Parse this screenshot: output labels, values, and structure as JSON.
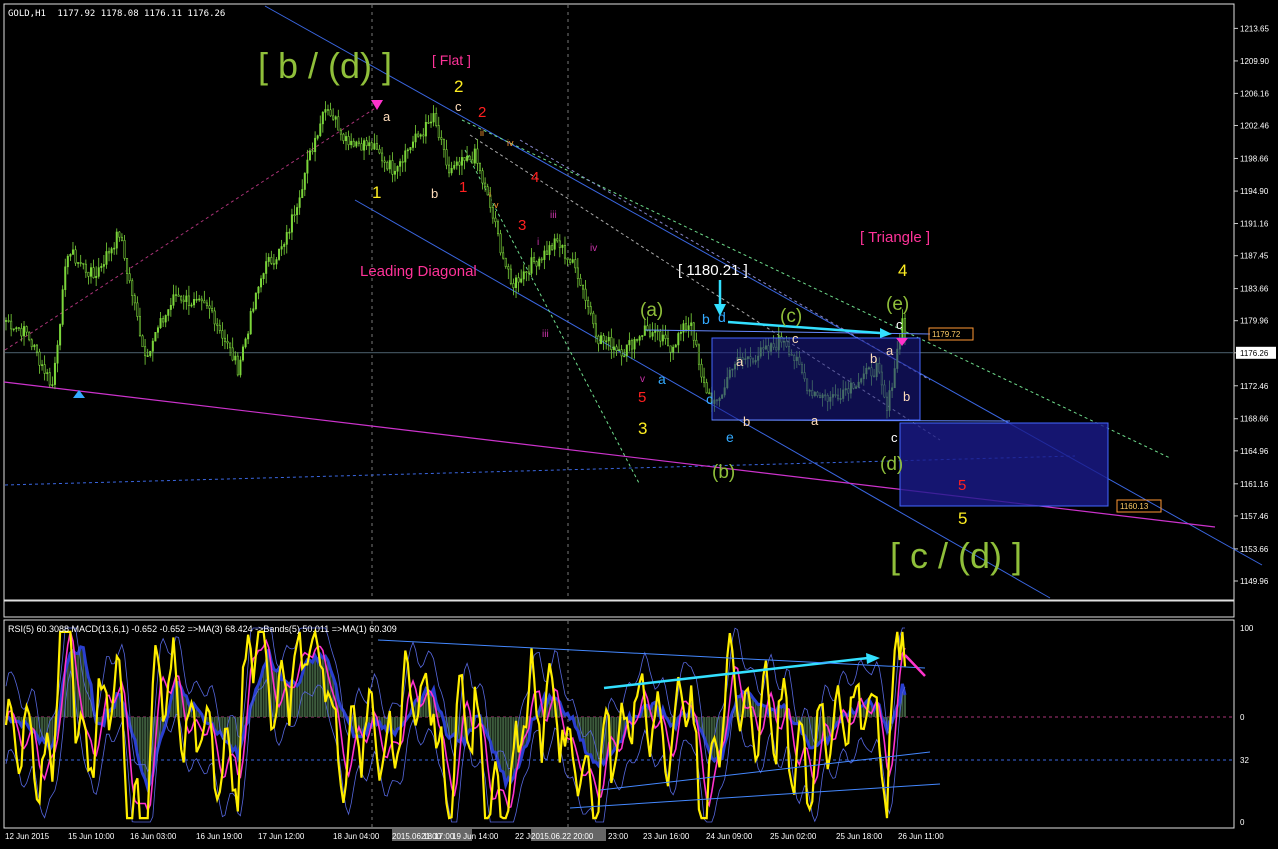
{
  "header": {
    "symbol": "GOLD,H1",
    "ohlc": "1177.92 1178.08 1176.11 1176.26"
  },
  "indicator_header": "RSI(5) 60.3088  MACD(13,6,1) -0.652 -0.652  =>MA(3) 68.424  ->Bands(5) 50.011  =>MA(1) 60.309",
  "colors": {
    "background": "#000000",
    "bull_candle": "#7cd63b",
    "bear_candle": "#7cd63b",
    "channel_line": "#3a66e0",
    "pink_line": "#cc33cc",
    "cyan_arrow": "#33e0ff",
    "rsi_line": "#ffee00",
    "ma_line": "#ff33cc",
    "macd_fill": "#3c5a3c",
    "bands_fill": "#14147a",
    "box_fill": "#1a1a8c",
    "green_label": "#8fbf3a",
    "yellow_label": "#ffee22",
    "red_label": "#ff2020",
    "pink_label": "#ff3399",
    "white_label": "#ffffff",
    "blue_label": "#33aaff"
  },
  "price_labels": {
    "current": "1176.26",
    "box_top": "1179.72",
    "box_bottom": "1160.13"
  },
  "annotations": {
    "b_d": "[ b / (d) ]",
    "flat": "[ Flat ]",
    "leading_diagonal": "Leading Diagonal",
    "price_box": "[ 1180.21 ]",
    "triangle": "[ Triangle ]",
    "c_d": "[ c / (d) ]",
    "w_a": "(a)",
    "w_b": "(b)",
    "w_c": "(c)",
    "w_d": "(d)",
    "w_e": "(e)",
    "n1_yellow": "1",
    "n2_yellow": "2",
    "n3_yellow": "3",
    "n4_yellow": "4",
    "n5_yellow": "5",
    "n1_red": "1",
    "n2_red": "2",
    "n3_red": "3",
    "n4_red": "4",
    "n5_red": "5",
    "n5_red_b": "5",
    "l_a1": "a",
    "l_b1": "b",
    "l_c1": "c",
    "l_a2": "a",
    "l_b2": "b",
    "l_c2": "c",
    "l_a3": "a",
    "l_b3": "b",
    "l_c3": "c",
    "l_a4": "a",
    "l_b4": "b",
    "l_c4": "c",
    "l_b5": "b",
    "l_c5": "c",
    "l_d5": "d",
    "l_e5": "e",
    "l_a5": "a",
    "l_c6": "c",
    "r_i": "i",
    "r_ii": "ii",
    "r_iii": "iii",
    "r_iv": "iv",
    "r_v": "v",
    "r_i2": "i",
    "r_ii2": "ii",
    "r_iii2": "iii",
    "r_iv2": "iv",
    "r_v2": "v"
  },
  "chart_data": {
    "type": "candlestick",
    "symbol": "GOLD,H1",
    "price_axis": {
      "ylim": [
        1148.0,
        1216.0
      ],
      "ticks": [
        "1213.65",
        "1209.90",
        "1206.16",
        "1202.46",
        "1198.66",
        "1194.90",
        "1191.16",
        "1187.45",
        "1183.66",
        "1179.96",
        "1176.26",
        "1172.46",
        "1168.66",
        "1164.96",
        "1161.16",
        "1157.46",
        "1153.66",
        "1149.96"
      ]
    },
    "time_axis": {
      "labels": [
        "12 Jun 2015",
        "15 Jun 10:00",
        "16 Jun 03:00",
        "16 Jun 19:00",
        "17 Jun 12:00",
        "18 Jun 04:00",
        "2015.06.18 17:00",
        "21:00",
        "19 Jun 14:00",
        "22 Jun 06:00",
        "2015.06.22 20:00",
        "23:00",
        "23 Jun 16:00",
        "24 Jun 09:00",
        "25 Jun 02:00",
        "25 Jun 18:00",
        "26 Jun 11:00"
      ]
    },
    "price_pivots": [
      {
        "t": 0,
        "p": 1180.0
      },
      {
        "t": 8,
        "p": 1178.5
      },
      {
        "t": 18,
        "p": 1172.5
      },
      {
        "t": 24,
        "p": 1188.0
      },
      {
        "t": 34,
        "p": 1185.0
      },
      {
        "t": 44,
        "p": 1190.0
      },
      {
        "t": 54,
        "p": 1176.0
      },
      {
        "t": 66,
        "p": 1183.0
      },
      {
        "t": 80,
        "p": 1181.0
      },
      {
        "t": 90,
        "p": 1174.5
      },
      {
        "t": 100,
        "p": 1186.0
      },
      {
        "t": 108,
        "p": 1188.5
      },
      {
        "t": 118,
        "p": 1199.0
      },
      {
        "t": 124,
        "p": 1205.0
      },
      {
        "t": 132,
        "p": 1201.0
      },
      {
        "t": 142,
        "p": 1200.0
      },
      {
        "t": 150,
        "p": 1197.5
      },
      {
        "t": 158,
        "p": 1200.5
      },
      {
        "t": 166,
        "p": 1203.2
      },
      {
        "t": 172,
        "p": 1197.0
      },
      {
        "t": 182,
        "p": 1199.0
      },
      {
        "t": 188,
        "p": 1193.0
      },
      {
        "t": 196,
        "p": 1184.0
      },
      {
        "t": 204,
        "p": 1186.5
      },
      {
        "t": 214,
        "p": 1189.0
      },
      {
        "t": 222,
        "p": 1185.5
      },
      {
        "t": 230,
        "p": 1178.0
      },
      {
        "t": 240,
        "p": 1176.5
      },
      {
        "t": 248,
        "p": 1179.0
      },
      {
        "t": 258,
        "p": 1177.0
      },
      {
        "t": 266,
        "p": 1180.0
      },
      {
        "t": 270,
        "p": 1173.0
      },
      {
        "t": 276,
        "p": 1170.0
      },
      {
        "t": 282,
        "p": 1175.0
      },
      {
        "t": 296,
        "p": 1176.5
      },
      {
        "t": 302,
        "p": 1178.0
      },
      {
        "t": 312,
        "p": 1172.0
      },
      {
        "t": 320,
        "p": 1171.0
      },
      {
        "t": 330,
        "p": 1173.0
      },
      {
        "t": 338,
        "p": 1174.5
      },
      {
        "t": 342,
        "p": 1169.5
      },
      {
        "t": 348,
        "p": 1180.0
      },
      {
        "t": 350,
        "p": 1176.26
      }
    ],
    "candle_count": 350,
    "oscillator": {
      "ylim": [
        0,
        100
      ],
      "ticks": [
        "100",
        "0",
        "32",
        "0"
      ],
      "rsi_last": 60.3088,
      "macd": [
        -0.652,
        -0.652
      ],
      "ma3": 68.424,
      "bands5": 50.011,
      "ma1": 60.309
    }
  }
}
